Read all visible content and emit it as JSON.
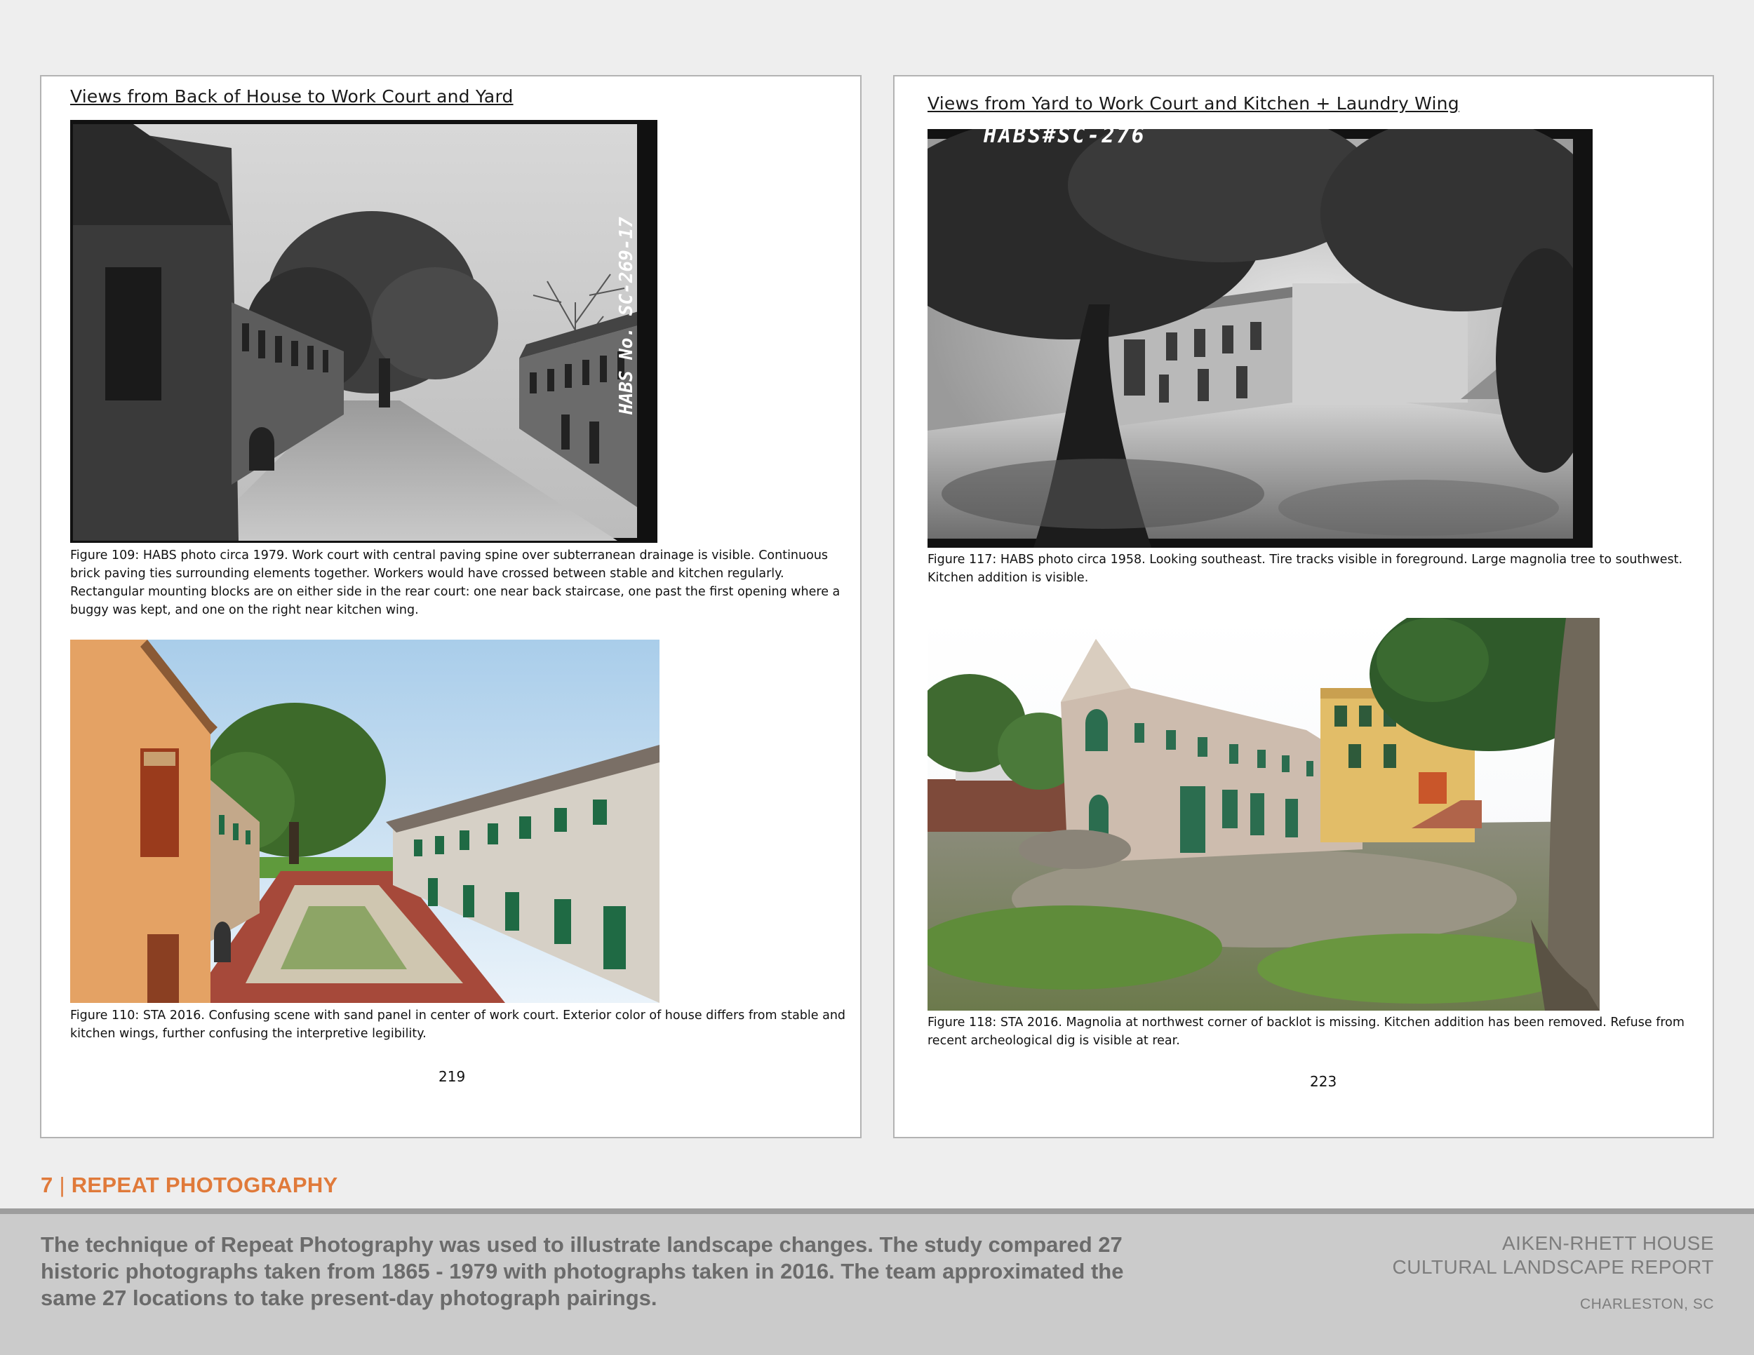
{
  "left_page": {
    "heading": "Views from Back of House to Work Court and Yard",
    "photo_top": {
      "negative_label": "HABS No. SC-269-17"
    },
    "caption_top": "Figure 109: HABS photo circa 1979. Work court with central paving spine over subterranean drainage is visible. Continuous brick paving ties surrounding elements together. Workers would have crossed between stable and kitchen regularly. Rectangular mounting blocks are on either side in the rear court: one near back staircase, one past the first opening where a buggy was kept, and one on the right near kitchen wing.",
    "caption_bottom": "Figure 110: STA 2016. Confusing scene with sand panel in center of work court. Exterior color of house differs from stable and kitchen wings, further confusing the interpretive legibility.",
    "page_number": "219"
  },
  "right_page": {
    "heading": "Views from Yard to Work Court and Kitchen + Laundry Wing",
    "photo_top": {
      "negative_label": "HABS#SC-276"
    },
    "caption_top": "Figure 117: HABS photo circa 1958. Looking southeast. Tire tracks visible in foreground. Large magnolia tree to southwest. Kitchen addition is visible.",
    "caption_bottom": "Figure 118: STA 2016. Magnolia at northwest corner of backlot is missing. Kitchen addition has been removed. Refuse from recent archeological dig is visible at rear.",
    "page_number": "223"
  },
  "section": {
    "number": "7",
    "separator": "|",
    "title": "REPEAT PHOTOGRAPHY"
  },
  "footer": {
    "body": "The technique of Repeat Photography was used to illustrate landscape changes. The study compared 27 historic photographs taken from 1865 - 1979 with photographs taken in 2016. The team approximated the same 27 locations to take present-day photograph pairings.",
    "report_line1": "AIKEN-RHETT HOUSE",
    "report_line2": "CULTURAL LANDSCAPE REPORT",
    "location": "CHARLESTON, SC"
  },
  "colors": {
    "accent_orange": "#e07a3a",
    "footer_band": "#cbcbcb",
    "footer_text": "#6b6b6b"
  }
}
